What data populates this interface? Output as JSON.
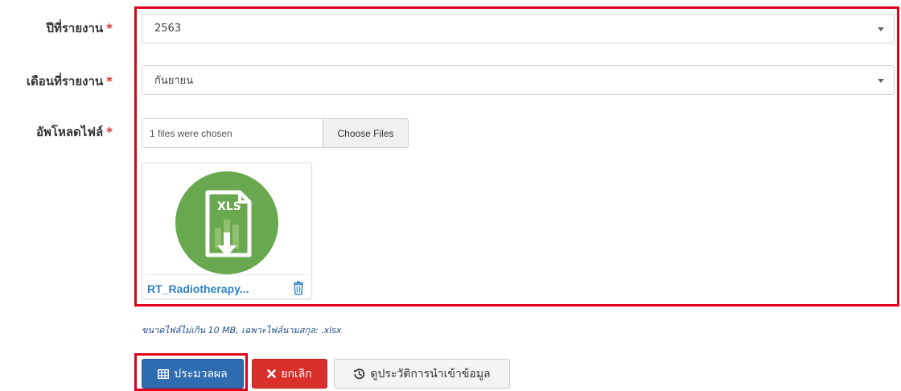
{
  "form": {
    "required_mark": "*",
    "year": {
      "label": "ปีที่รายงาน",
      "value": "2563"
    },
    "month": {
      "label": "เดือนที่รายงาน",
      "value": "กันยายน"
    },
    "upload": {
      "label": "อัพโหลดไฟล์",
      "chosen_text": "1 files were chosen",
      "button_label": "Choose Files",
      "file": {
        "name": "RT_Radiotherapy...",
        "type_badge": "XLS"
      },
      "hint": "ขนาดไฟล์ไม่เกิน 10 MB, เฉพาะไฟล์นามสกุล: .xlsx"
    }
  },
  "actions": {
    "process": "ประมวลผล",
    "cancel": "ยกเลิก",
    "history": "ดูประวัติการนำเข้าข้อมูล"
  },
  "colors": {
    "highlight": "#e0001b",
    "primary": "#2f6db0",
    "danger": "#d9302c",
    "file_icon": "#6aa84f",
    "link": "#2e84c6"
  },
  "icons": {
    "process": "table-icon",
    "cancel": "times-icon",
    "history": "history-icon",
    "file": "xls-file-icon",
    "remove": "trash-icon",
    "select": "caret-down-icon"
  }
}
